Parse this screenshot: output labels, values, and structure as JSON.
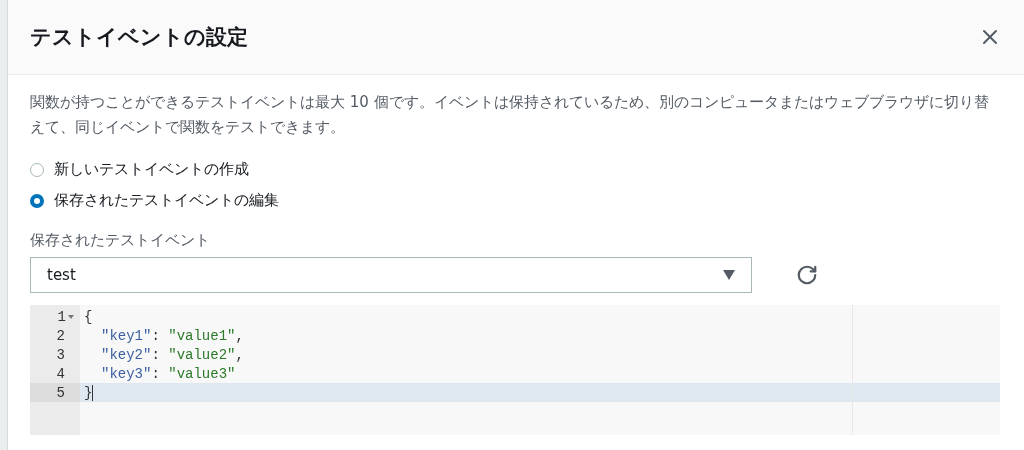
{
  "dialog": {
    "title": "テストイベントの設定",
    "description": "関数が持つことができるテストイベントは最大 10 個です。イベントは保持されているため、別のコンピュータまたはウェブブラウザに切り替えて、同じイベントで関数をテストできます。"
  },
  "options": [
    {
      "label": "新しいテストイベントの作成",
      "selected": false
    },
    {
      "label": "保存されたテストイベントの編集",
      "selected": true
    }
  ],
  "saved_event": {
    "label": "保存されたテストイベント",
    "value": "test"
  },
  "editor": {
    "lines": [
      {
        "number": "1",
        "foldable": true,
        "active": false,
        "indented": false,
        "tokens": [
          {
            "kind": "punct",
            "text": "{"
          }
        ]
      },
      {
        "number": "2",
        "foldable": false,
        "active": false,
        "indented": true,
        "tokens": [
          {
            "kind": "key",
            "text": "\"key1\""
          },
          {
            "kind": "punct",
            "text": ": "
          },
          {
            "kind": "string",
            "text": "\"value1\""
          },
          {
            "kind": "punct",
            "text": ","
          }
        ]
      },
      {
        "number": "3",
        "foldable": false,
        "active": false,
        "indented": true,
        "tokens": [
          {
            "kind": "key",
            "text": "\"key2\""
          },
          {
            "kind": "punct",
            "text": ": "
          },
          {
            "kind": "string",
            "text": "\"value2\""
          },
          {
            "kind": "punct",
            "text": ","
          }
        ]
      },
      {
        "number": "4",
        "foldable": false,
        "active": false,
        "indented": true,
        "tokens": [
          {
            "kind": "key",
            "text": "\"key3\""
          },
          {
            "kind": "punct",
            "text": ": "
          },
          {
            "kind": "string",
            "text": "\"value3\""
          }
        ]
      },
      {
        "number": "5",
        "foldable": false,
        "active": true,
        "indented": false,
        "tokens": [
          {
            "kind": "punct",
            "text": "}"
          }
        ]
      }
    ]
  }
}
